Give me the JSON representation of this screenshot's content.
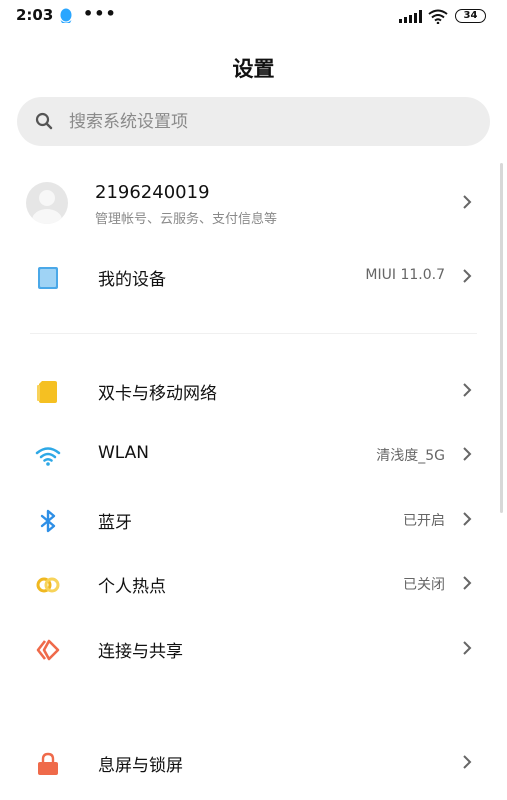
{
  "status_bar": {
    "time": "2:03",
    "more_dots": "•••",
    "battery_level": "34"
  },
  "page": {
    "title": "设置"
  },
  "search": {
    "placeholder": "搜索系统设置项"
  },
  "account": {
    "name": "2196240019",
    "subtitle": "管理帐号、云服务、支付信息等"
  },
  "rows": [
    {
      "label": "我的设备",
      "value": "MIUI 11.0.7",
      "icon": "device-icon",
      "color": "#4aa8e8"
    },
    {
      "label": "双卡与移动网络",
      "value": "",
      "icon": "sim-icon",
      "color": "#f5c022"
    },
    {
      "label": "WLAN",
      "value": "清浅度_5G",
      "icon": "wifi-icon",
      "color": "#2ea8e6"
    },
    {
      "label": "蓝牙",
      "value": "已开启",
      "icon": "bluetooth-icon",
      "color": "#2e8fe6"
    },
    {
      "label": "个人热点",
      "value": "已关闭",
      "icon": "hotspot-icon",
      "color": "#f0b820"
    },
    {
      "label": "连接与共享",
      "value": "",
      "icon": "share-icon",
      "color": "#ef6a4a"
    },
    {
      "label": "息屏与锁屏",
      "value": "",
      "icon": "lock-icon",
      "color": "#ef6a4a"
    }
  ]
}
